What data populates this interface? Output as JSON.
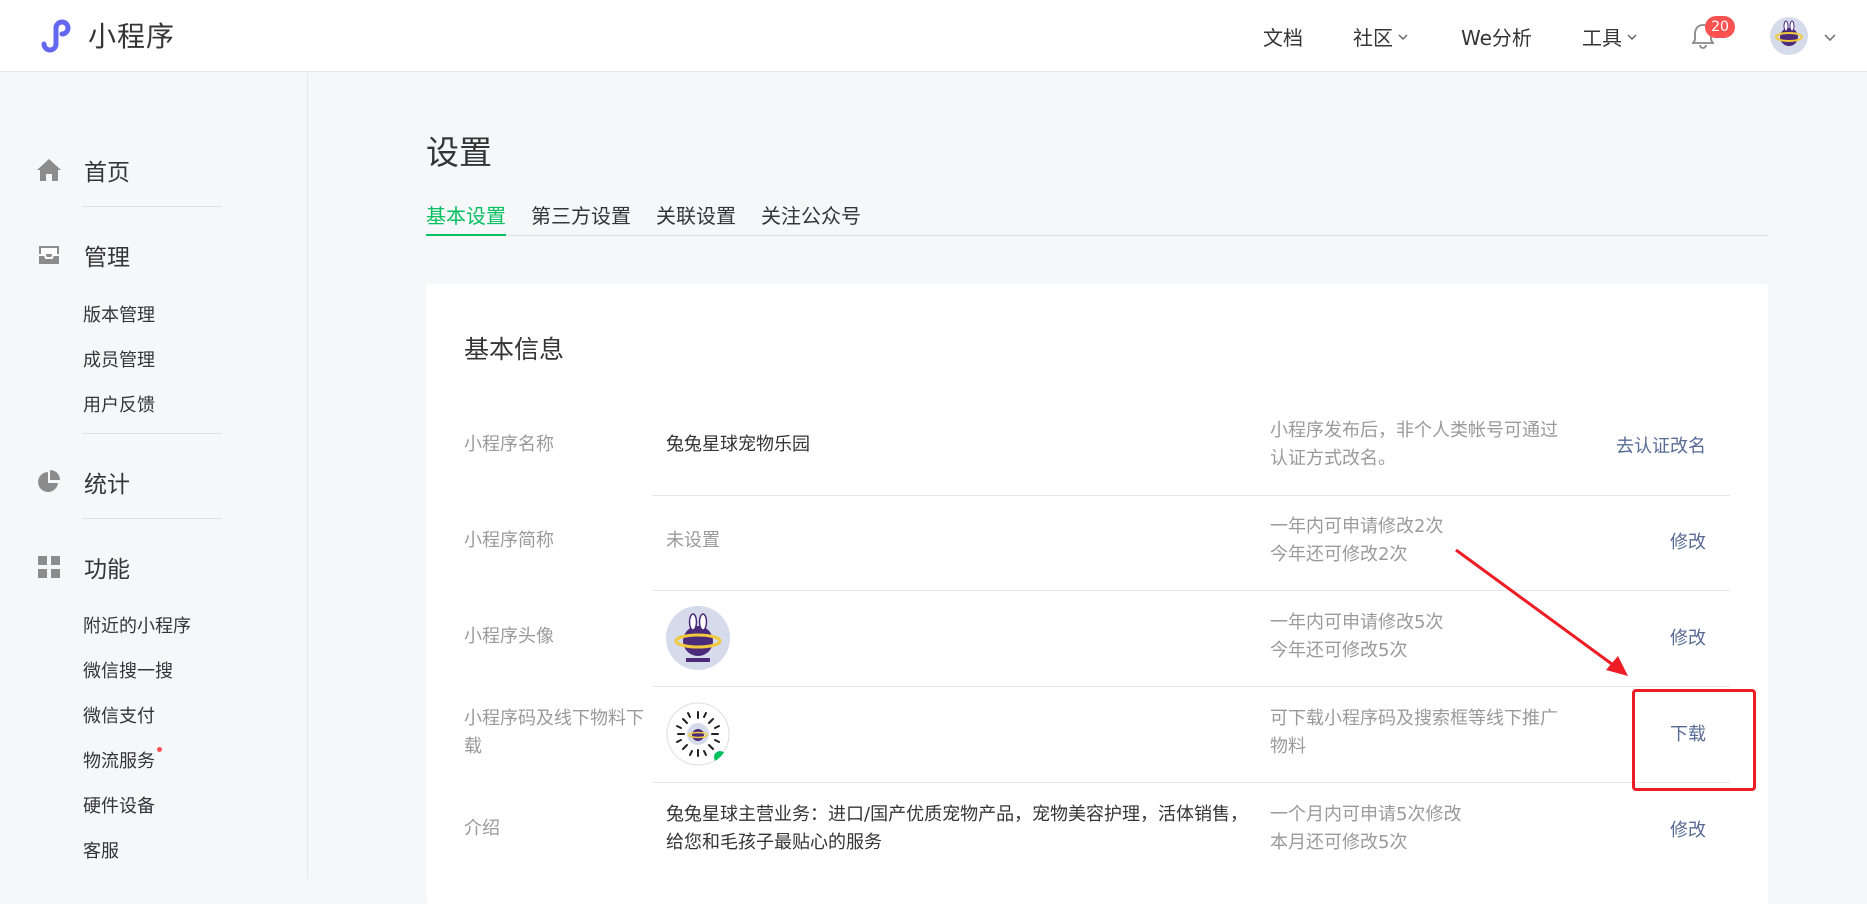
{
  "brand": {
    "name": "小程序",
    "color": "#6467f0"
  },
  "topnav": {
    "items": [
      {
        "label": "文档",
        "has_chevron": false
      },
      {
        "label": "社区",
        "has_chevron": true
      },
      {
        "label": "We分析",
        "has_chevron": false
      },
      {
        "label": "工具",
        "has_chevron": true
      }
    ],
    "notification_count": "20"
  },
  "sidebar": {
    "sections": [
      {
        "label": "首页",
        "icon": "home-icon"
      },
      {
        "label": "管理",
        "icon": "inbox-icon",
        "items": [
          "版本管理",
          "成员管理",
          "用户反馈"
        ]
      },
      {
        "label": "统计",
        "icon": "pie-chart-icon"
      },
      {
        "label": "功能",
        "icon": "grid-icon",
        "items": [
          "附近的小程序",
          "微信搜一搜",
          "微信支付",
          "物流服务",
          "硬件设备",
          "客服"
        ]
      }
    ]
  },
  "main": {
    "title": "设置",
    "tabs": [
      "基本设置",
      "第三方设置",
      "关联设置",
      "关注公众号"
    ],
    "active_tab": 0,
    "card": {
      "title": "基本信息",
      "rows": [
        {
          "label": "小程序名称",
          "value": "兔兔星球宠物乐园",
          "desc_line1": "小程序发布后，非个人类帐号可通过",
          "desc_line2": "认证方式改名。",
          "action": "去认证改名"
        },
        {
          "label": "小程序简称",
          "value": "未设置",
          "desc_line1": "一年内可申请修改2次",
          "desc_line2": "今年还可修改2次",
          "action": "修改"
        },
        {
          "label": "小程序头像",
          "value": "",
          "desc_line1": "一年内可申请修改5次",
          "desc_line2": "今年还可修改5次",
          "action": "修改"
        },
        {
          "label_line1": "小程序码及线下物料下",
          "label_line2": "载",
          "value": "",
          "desc_line1": "可下载小程序码及搜索框等线下推广",
          "desc_line2": "物料",
          "action": "下载"
        },
        {
          "label": "介绍",
          "value_line1": "兔兔星球主营业务：进口/国产优质宠物产品，宠物美容护理，活体销售，",
          "value_line2": "给您和毛孩子最贴心的服务",
          "desc_line1": "一个月内可申请5次修改",
          "desc_line2": "本月还可修改5次",
          "action": "修改"
        }
      ]
    }
  },
  "colors": {
    "accent": "#07c160",
    "link": "#576b95",
    "annotation": "#ee1c25",
    "badge": "#fa5151"
  }
}
